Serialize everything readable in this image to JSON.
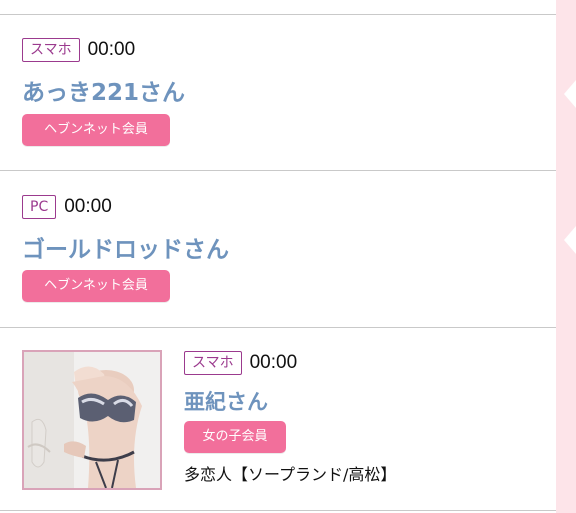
{
  "colors": {
    "accent_pink": "#f26f9b",
    "device_tag": "#9b3a8e",
    "name_blue": "#6e93bd",
    "strip_pink": "#fde4e9"
  },
  "visitors": [
    {
      "device": "スマホ",
      "time": "00:00",
      "name": "あっき221さん",
      "badge": "ヘブンネット会員"
    },
    {
      "device": "PC",
      "time": "00:00",
      "name": "ゴールドロッドさん",
      "badge": "ヘブンネット会員"
    },
    {
      "device": "スマホ",
      "time": "00:00",
      "name": "亜紀さん",
      "badge": "女の子会員",
      "shop": "多恋人【ソープランド/高松】",
      "photo_icon": "profile-photo"
    }
  ]
}
